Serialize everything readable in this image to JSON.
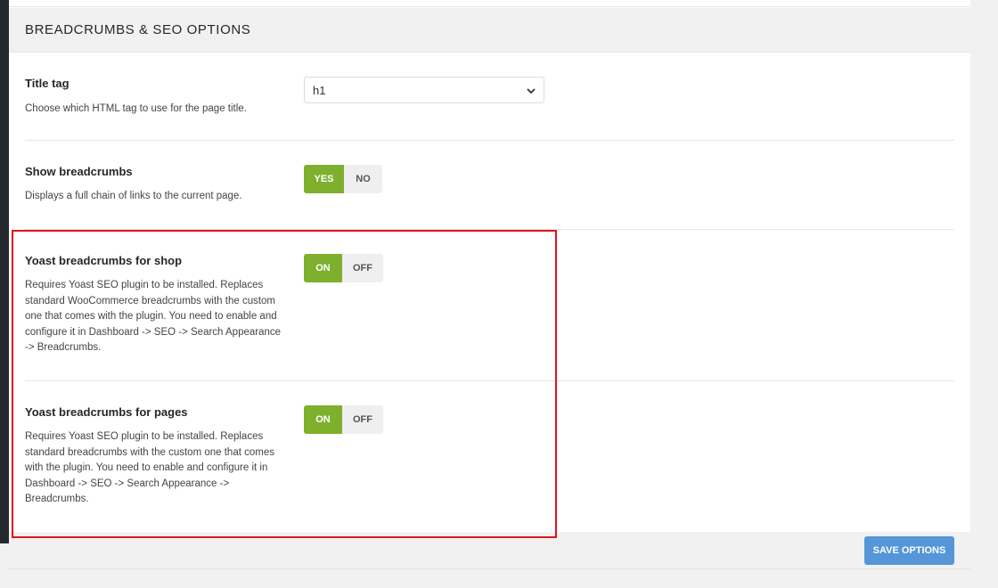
{
  "section": {
    "title": "BREADCRUMBS & SEO OPTIONS"
  },
  "title_tag": {
    "label": "Title tag",
    "description": "Choose which HTML tag to use for the page title.",
    "selected": "h1",
    "icon": "chevron-down-icon"
  },
  "show_breadcrumbs": {
    "label": "Show breadcrumbs",
    "description": "Displays a full chain of links to the current page.",
    "on_label": "YES",
    "off_label": "NO",
    "value": "YES"
  },
  "yoast_shop": {
    "label": "Yoast breadcrumbs for shop",
    "description_lines": [
      "Requires Yoast SEO plugin to be installed. Replaces",
      "standard WooCommerce breadcrumbs with the custom",
      "one that comes with the plugin. You need to enable and",
      "configure it in Dashboard -> SEO -> Search Appearance",
      "-> Breadcrumbs."
    ],
    "on_label": "ON",
    "off_label": "OFF",
    "value": "ON"
  },
  "yoast_pages": {
    "label": "Yoast breadcrumbs for pages",
    "description_lines": [
      "Requires Yoast SEO plugin to be installed. Replaces",
      "standard breadcrumbs with the custom one that comes",
      "with the plugin. You need to enable and configure it in",
      "Dashboard -> SEO -> Search Appearance ->",
      "Breadcrumbs."
    ],
    "on_label": "ON",
    "off_label": "OFF",
    "value": "ON"
  },
  "footer": {
    "save_label": "SAVE OPTIONS"
  },
  "colors": {
    "toggle_active": "#7eb02d",
    "save_button": "#5496d8",
    "highlight": "#e0141e"
  }
}
